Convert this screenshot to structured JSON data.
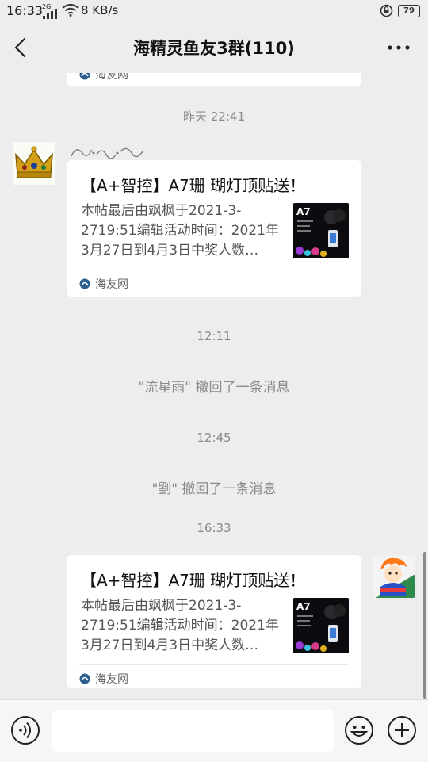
{
  "status_bar": {
    "time": "16:33",
    "network": "2G",
    "speed": "8 KB/s",
    "battery": "79"
  },
  "header": {
    "title": "海精灵鱼友3群(110)"
  },
  "messages": {
    "top_card_source": "海友网",
    "time1": "昨天 22:41",
    "card1": {
      "title": "【A+智控】A7珊 瑚灯顶贴送！",
      "description": "本帖最后由飒枫于2021-3-2719:51编辑活动时间：2021年3月27日到4月3日中奖人数…",
      "source": "海友网",
      "thumb_label": "A7"
    },
    "time2": "12:11",
    "notice1": "\"流星雨\" 撤回了一条消息",
    "time3": "12:45",
    "notice2": "\"劉\" 撤回了一条消息",
    "time4": "16:33",
    "card2": {
      "title": "【A+智控】A7珊 瑚灯顶贴送！",
      "description": "本帖最后由飒枫于2021-3-2719:51编辑活动时间：2021年3月27日到4月3日中奖人数…",
      "source": "海友网",
      "thumb_label": "A7"
    }
  },
  "icons": {
    "back": "chevron-left-icon",
    "more": "more-dots-icon",
    "voice": "voice-icon",
    "emoji": "emoji-icon",
    "add": "plus-icon"
  },
  "colors": {
    "background": "#ededed",
    "card": "#ffffff",
    "muted_text": "#8a8a8a"
  }
}
